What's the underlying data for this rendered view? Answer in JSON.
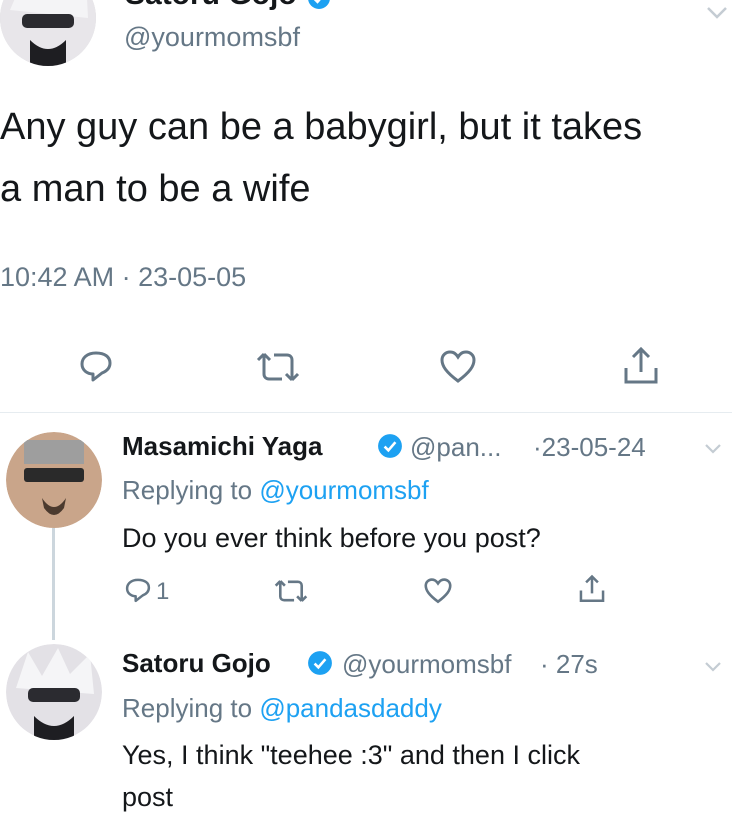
{
  "main_tweet": {
    "display_name": "Satoru Gojo",
    "handle": "@yourmomsbf",
    "text_line1": "Any guy can be a babygirl, but it takes",
    "text_line2": "a man to be a wife",
    "timestamp": "10:42 AM · 23-05-05"
  },
  "replies": [
    {
      "display_name": "Masamichi Yaga",
      "handle": "@pan...",
      "date": "·23-05-24",
      "replying_prefix": "Replying to",
      "replying_to": "@yourmomsbf",
      "text": "Do you ever think before you post?",
      "reply_count": "1"
    },
    {
      "display_name": "Satoru Gojo",
      "handle": "@yourmomsbf",
      "date": "· 27s",
      "replying_prefix": "Replying to",
      "replying_to": "@pandasdaddy",
      "text_line1": "Yes, I think \"teehee :3\" and then I click",
      "text_line2": "post"
    }
  ],
  "colors": {
    "accent": "#1da1f2",
    "text": "#14171a",
    "muted": "#657786"
  }
}
